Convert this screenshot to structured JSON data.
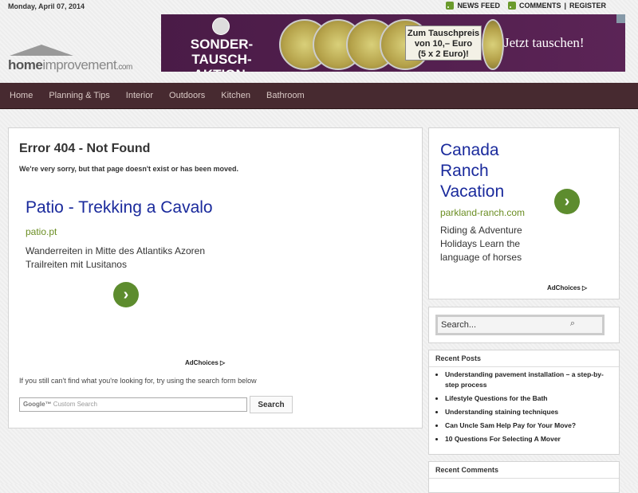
{
  "header": {
    "date": "Monday, April 07, 2014",
    "links": {
      "news_feed": "NEWS FEED",
      "comments": "COMMENTS",
      "separator": "|",
      "register": "REGISTER"
    },
    "logo": {
      "part1": "home",
      "part2": "improvement",
      "suffix": ".com"
    }
  },
  "banner": {
    "headline_1": "SONDER-",
    "headline_2": "TAUSCH-AKTION:",
    "box_line1": "Zum Tauschpreis",
    "box_line2": "von 10,– Euro",
    "box_line3": "(5 x 2 Euro)!",
    "cta": "Jetzt tauschen!"
  },
  "nav": {
    "items": [
      "Home",
      "Planning & Tips",
      "Interior",
      "Outdoors",
      "Kitchen",
      "Bathroom"
    ]
  },
  "main": {
    "title": "Error 404 - Not Found",
    "message": "We're very sorry, but that page doesn't exist or has been moved.",
    "ad": {
      "title": "Patio - Trekking a Cavalo",
      "url": "patio.pt",
      "text": "Wanderreiten in Mitte des Atlantiks Azoren Trailreiten mit Lusitanos",
      "adchoices": "AdChoices"
    },
    "hint": "If you still can't find what you're looking for, try using the search form below",
    "search": {
      "google": "Google™",
      "placeholder": "Custom Search",
      "button": "Search"
    }
  },
  "sidebar": {
    "ad": {
      "title": "Canada Ranch Vacation",
      "url": "parkland-ranch.com",
      "text": "Riding & Adventure Holidays Learn the language of horses",
      "adchoices": "AdChoices"
    },
    "search": {
      "placeholder": "Search..."
    },
    "recent_posts": {
      "title": "Recent Posts",
      "items": [
        "Understanding pavement installation – a step-by-step process",
        "Lifestyle Questions for the Bath",
        "Understanding staining techniques",
        "Can Uncle Sam Help Pay for Your Move?",
        "10 Questions For Selecting A Mover"
      ]
    },
    "recent_comments": {
      "title": "Recent Comments"
    }
  },
  "icons": {
    "rss": "rss-icon",
    "search": "search-icon",
    "arrow": "chevron-right-icon",
    "adchoices": "adchoices-icon"
  },
  "colors": {
    "nav_bg": "#472a30",
    "ad_title": "#1a2a9c",
    "ad_url": "#6b8e23",
    "arrow": "#5d8c2e",
    "banner_bg": "#4a1b47"
  }
}
